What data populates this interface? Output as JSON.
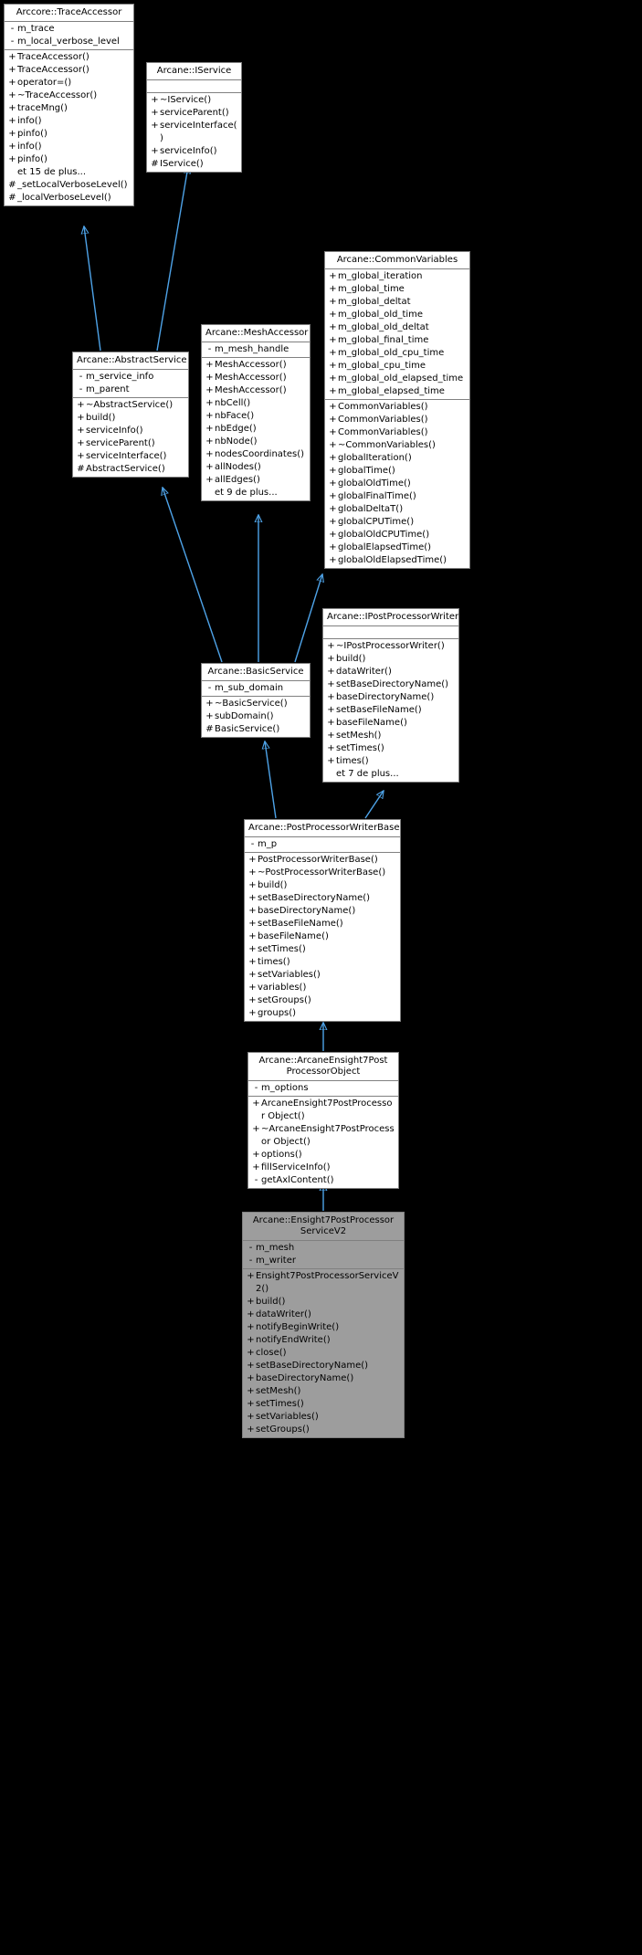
{
  "diagram": {
    "type": "uml-class-inheritance",
    "edge_color": "#4ea3e8",
    "node_bg": "#ffffff",
    "node_border": "#808080",
    "highlight_bg": "#9d9d9d",
    "background": "#000000",
    "more_label_prefix": "et",
    "more_label_suffix": "de plus..."
  },
  "nodes": {
    "traceaccessor": {
      "title": "Arccore::TraceAccessor",
      "attributes": [
        {
          "vis": "-",
          "name": "m_trace"
        },
        {
          "vis": "-",
          "name": "m_local_verbose_level"
        }
      ],
      "operations": [
        {
          "vis": "+",
          "name": "TraceAccessor()"
        },
        {
          "vis": "+",
          "name": "TraceAccessor()"
        },
        {
          "vis": "+",
          "name": "operator=()"
        },
        {
          "vis": "+",
          "name": "~TraceAccessor()"
        },
        {
          "vis": "+",
          "name": "traceMng()"
        },
        {
          "vis": "+",
          "name": "info()"
        },
        {
          "vis": "+",
          "name": "pinfo()"
        },
        {
          "vis": "+",
          "name": "info()"
        },
        {
          "vis": "+",
          "name": "pinfo()"
        },
        {
          "vis": "",
          "name": "et 15 de plus..."
        },
        {
          "vis": "#",
          "name": "_setLocalVerboseLevel()"
        },
        {
          "vis": "#",
          "name": "_localVerboseLevel()"
        }
      ]
    },
    "iservice": {
      "title": "Arcane::IService",
      "attributes": [],
      "operations": [
        {
          "vis": "+",
          "name": "~IService()"
        },
        {
          "vis": "+",
          "name": "serviceParent()"
        },
        {
          "vis": "+",
          "name": "serviceInterface()"
        },
        {
          "vis": "+",
          "name": "serviceInfo()"
        },
        {
          "vis": "#",
          "name": "IService()"
        }
      ]
    },
    "abstractservice": {
      "title": "Arcane::AbstractService",
      "attributes": [
        {
          "vis": "-",
          "name": "m_service_info"
        },
        {
          "vis": "-",
          "name": "m_parent"
        }
      ],
      "operations": [
        {
          "vis": "+",
          "name": "~AbstractService()"
        },
        {
          "vis": "+",
          "name": "build()"
        },
        {
          "vis": "+",
          "name": "serviceInfo()"
        },
        {
          "vis": "+",
          "name": "serviceParent()"
        },
        {
          "vis": "+",
          "name": "serviceInterface()"
        },
        {
          "vis": "#",
          "name": "AbstractService()"
        }
      ]
    },
    "meshaccessor": {
      "title": "Arcane::MeshAccessor",
      "attributes": [
        {
          "vis": "-",
          "name": "m_mesh_handle"
        }
      ],
      "operations": [
        {
          "vis": "+",
          "name": "MeshAccessor()"
        },
        {
          "vis": "+",
          "name": "MeshAccessor()"
        },
        {
          "vis": "+",
          "name": "MeshAccessor()"
        },
        {
          "vis": "+",
          "name": "nbCell()"
        },
        {
          "vis": "+",
          "name": "nbFace()"
        },
        {
          "vis": "+",
          "name": "nbEdge()"
        },
        {
          "vis": "+",
          "name": "nbNode()"
        },
        {
          "vis": "+",
          "name": "nodesCoordinates()"
        },
        {
          "vis": "+",
          "name": "allNodes()"
        },
        {
          "vis": "+",
          "name": "allEdges()"
        },
        {
          "vis": "",
          "name": "et 9 de plus..."
        }
      ]
    },
    "commonvariables": {
      "title": "Arcane::CommonVariables",
      "attributes": [
        {
          "vis": "+",
          "name": "m_global_iteration"
        },
        {
          "vis": "+",
          "name": "m_global_time"
        },
        {
          "vis": "+",
          "name": "m_global_deltat"
        },
        {
          "vis": "+",
          "name": "m_global_old_time"
        },
        {
          "vis": "+",
          "name": "m_global_old_deltat"
        },
        {
          "vis": "+",
          "name": "m_global_final_time"
        },
        {
          "vis": "+",
          "name": "m_global_old_cpu_time"
        },
        {
          "vis": "+",
          "name": "m_global_cpu_time"
        },
        {
          "vis": "+",
          "name": "m_global_old_elapsed_time"
        },
        {
          "vis": "+",
          "name": "m_global_elapsed_time"
        }
      ],
      "operations": [
        {
          "vis": "+",
          "name": "CommonVariables()"
        },
        {
          "vis": "+",
          "name": "CommonVariables()"
        },
        {
          "vis": "+",
          "name": "CommonVariables()"
        },
        {
          "vis": "+",
          "name": "~CommonVariables()"
        },
        {
          "vis": "+",
          "name": "globalIteration()"
        },
        {
          "vis": "+",
          "name": "globalTime()"
        },
        {
          "vis": "+",
          "name": "globalOldTime()"
        },
        {
          "vis": "+",
          "name": "globalFinalTime()"
        },
        {
          "vis": "+",
          "name": "globalDeltaT()"
        },
        {
          "vis": "+",
          "name": "globalCPUTime()"
        },
        {
          "vis": "+",
          "name": "globalOldCPUTime()"
        },
        {
          "vis": "+",
          "name": "globalElapsedTime()"
        },
        {
          "vis": "+",
          "name": "globalOldElapsedTime()"
        }
      ]
    },
    "basicservice": {
      "title": "Arcane::BasicService",
      "attributes": [
        {
          "vis": "-",
          "name": "m_sub_domain"
        }
      ],
      "operations": [
        {
          "vis": "+",
          "name": "~BasicService()"
        },
        {
          "vis": "+",
          "name": "subDomain()"
        },
        {
          "vis": "#",
          "name": "BasicService()"
        }
      ]
    },
    "ipostprocessorwriter": {
      "title": "Arcane::IPostProcessorWriter",
      "attributes": [],
      "operations": [
        {
          "vis": "+",
          "name": "~IPostProcessorWriter()"
        },
        {
          "vis": "+",
          "name": "build()"
        },
        {
          "vis": "+",
          "name": "dataWriter()"
        },
        {
          "vis": "+",
          "name": "setBaseDirectoryName()"
        },
        {
          "vis": "+",
          "name": "baseDirectoryName()"
        },
        {
          "vis": "+",
          "name": "setBaseFileName()"
        },
        {
          "vis": "+",
          "name": "baseFileName()"
        },
        {
          "vis": "+",
          "name": "setMesh()"
        },
        {
          "vis": "+",
          "name": "setTimes()"
        },
        {
          "vis": "+",
          "name": "times()"
        },
        {
          "vis": "",
          "name": "et 7 de plus..."
        }
      ]
    },
    "postprocessorwriterbase": {
      "title": "Arcane::PostProcessorWriterBase",
      "attributes": [
        {
          "vis": "-",
          "name": "m_p"
        }
      ],
      "operations": [
        {
          "vis": "+",
          "name": "PostProcessorWriterBase()"
        },
        {
          "vis": "+",
          "name": "~PostProcessorWriterBase()"
        },
        {
          "vis": "+",
          "name": "build()"
        },
        {
          "vis": "+",
          "name": "setBaseDirectoryName()"
        },
        {
          "vis": "+",
          "name": "baseDirectoryName()"
        },
        {
          "vis": "+",
          "name": "setBaseFileName()"
        },
        {
          "vis": "+",
          "name": "baseFileName()"
        },
        {
          "vis": "+",
          "name": "setTimes()"
        },
        {
          "vis": "+",
          "name": "times()"
        },
        {
          "vis": "+",
          "name": "setVariables()"
        },
        {
          "vis": "+",
          "name": "variables()"
        },
        {
          "vis": "+",
          "name": "setGroups()"
        },
        {
          "vis": "+",
          "name": "groups()"
        }
      ]
    },
    "arcaneensight7postprocessorobject": {
      "title": "Arcane::ArcaneEnsight7Post\nProcessorObject",
      "attributes": [
        {
          "vis": "-",
          "name": "m_options"
        }
      ],
      "operations": [
        {
          "vis": "+",
          "name": "ArcaneEnsight7PostProcessor\nObject()"
        },
        {
          "vis": "+",
          "name": "~ArcaneEnsight7PostProcessor\nObject()"
        },
        {
          "vis": "+",
          "name": "options()"
        },
        {
          "vis": "+",
          "name": "fillServiceInfo()"
        },
        {
          "vis": "-",
          "name": "getAxlContent()"
        }
      ]
    },
    "ensight7postprocessorservicev2": {
      "title": "Arcane::Ensight7PostProcessor\nServiceV2",
      "highlighted": true,
      "attributes": [
        {
          "vis": "-",
          "name": "m_mesh"
        },
        {
          "vis": "-",
          "name": "m_writer"
        }
      ],
      "operations": [
        {
          "vis": "+",
          "name": "Ensight7PostProcessorServiceV2()"
        },
        {
          "vis": "+",
          "name": "build()"
        },
        {
          "vis": "+",
          "name": "dataWriter()"
        },
        {
          "vis": "+",
          "name": "notifyBeginWrite()"
        },
        {
          "vis": "+",
          "name": "notifyEndWrite()"
        },
        {
          "vis": "+",
          "name": "close()"
        },
        {
          "vis": "+",
          "name": "setBaseDirectoryName()"
        },
        {
          "vis": "+",
          "name": "baseDirectoryName()"
        },
        {
          "vis": "+",
          "name": "setMesh()"
        },
        {
          "vis": "+",
          "name": "setTimes()"
        },
        {
          "vis": "+",
          "name": "setVariables()"
        },
        {
          "vis": "+",
          "name": "setGroups()"
        }
      ]
    }
  },
  "edges": [
    {
      "from": "abstractservice",
      "to": "traceaccessor",
      "kind": "inheritance"
    },
    {
      "from": "abstractservice",
      "to": "iservice",
      "kind": "inheritance"
    },
    {
      "from": "basicservice",
      "to": "abstractservice",
      "kind": "inheritance"
    },
    {
      "from": "basicservice",
      "to": "meshaccessor",
      "kind": "inheritance"
    },
    {
      "from": "basicservice",
      "to": "commonvariables",
      "kind": "inheritance"
    },
    {
      "from": "postprocessorwriterbase",
      "to": "basicservice",
      "kind": "inheritance"
    },
    {
      "from": "postprocessorwriterbase",
      "to": "ipostprocessorwriter",
      "kind": "inheritance"
    },
    {
      "from": "arcaneensight7postprocessorobject",
      "to": "postprocessorwriterbase",
      "kind": "inheritance"
    },
    {
      "from": "ensight7postprocessorservicev2",
      "to": "arcaneensight7postprocessorobject",
      "kind": "inheritance"
    }
  ]
}
